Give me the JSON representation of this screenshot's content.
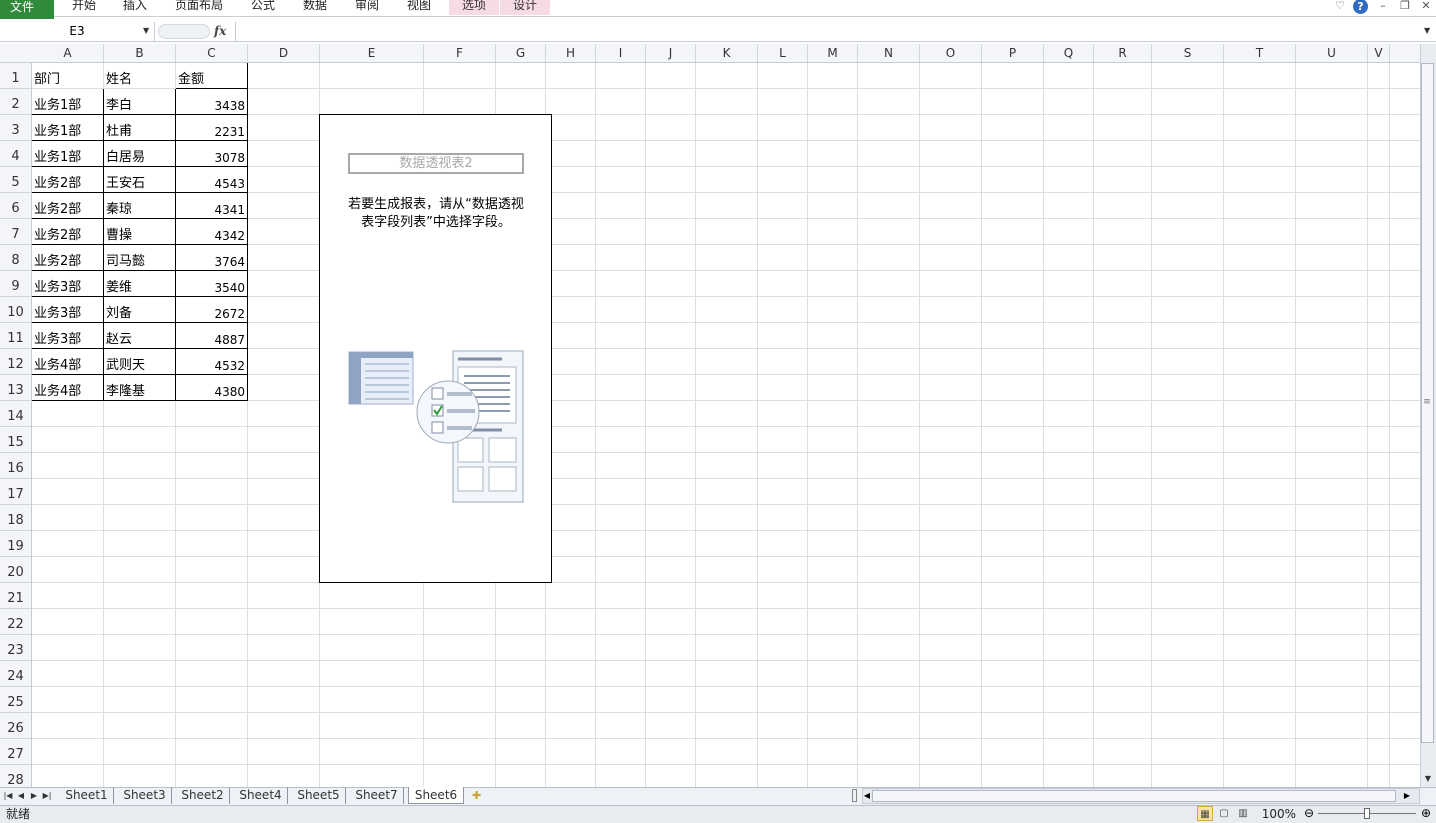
{
  "ribbon": {
    "file": "文件",
    "tabs": [
      "开始",
      "插入",
      "页面布局",
      "公式",
      "数据",
      "审阅",
      "视图"
    ],
    "context_tabs": [
      "选项",
      "设计"
    ]
  },
  "formula_bar": {
    "name_box": "E3",
    "fx": "fx",
    "content": ""
  },
  "columns": [
    "A",
    "B",
    "C",
    "D",
    "E",
    "F",
    "G",
    "H",
    "I",
    "J",
    "K",
    "L",
    "M",
    "N",
    "O",
    "P",
    "Q",
    "R",
    "S",
    "T",
    "U",
    "V"
  ],
  "rows": [
    "1",
    "2",
    "3",
    "4",
    "5",
    "6",
    "7",
    "8",
    "9",
    "10",
    "11",
    "12",
    "13",
    "14",
    "15",
    "16",
    "17",
    "18",
    "19",
    "20",
    "21",
    "22",
    "23",
    "24",
    "25",
    "26",
    "27",
    "28"
  ],
  "table": {
    "headers": [
      "部门",
      "姓名",
      "金额"
    ],
    "rows": [
      [
        "业务1部",
        "李白",
        "3438"
      ],
      [
        "业务1部",
        "杜甫",
        "2231"
      ],
      [
        "业务1部",
        "白居易",
        "3078"
      ],
      [
        "业务2部",
        "王安石",
        "4543"
      ],
      [
        "业务2部",
        "秦琼",
        "4341"
      ],
      [
        "业务2部",
        "曹操",
        "4342"
      ],
      [
        "业务2部",
        "司马懿",
        "3764"
      ],
      [
        "业务3部",
        "姜维",
        "3540"
      ],
      [
        "业务3部",
        "刘备",
        "2672"
      ],
      [
        "业务3部",
        "赵云",
        "4887"
      ],
      [
        "业务4部",
        "武则天",
        "4532"
      ],
      [
        "业务4部",
        "李隆基",
        "4380"
      ]
    ]
  },
  "pivot": {
    "name": "数据透视表2",
    "message_line1": "若要生成报表，请从“数据透视",
    "message_line2": "表字段列表”中选择字段。"
  },
  "sheets": [
    "Sheet1",
    "Sheet3",
    "Sheet2",
    "Sheet4",
    "Sheet5",
    "Sheet7",
    "Sheet6"
  ],
  "active_sheet": "Sheet6",
  "status": {
    "ready": "就绪",
    "zoom": "100%"
  }
}
